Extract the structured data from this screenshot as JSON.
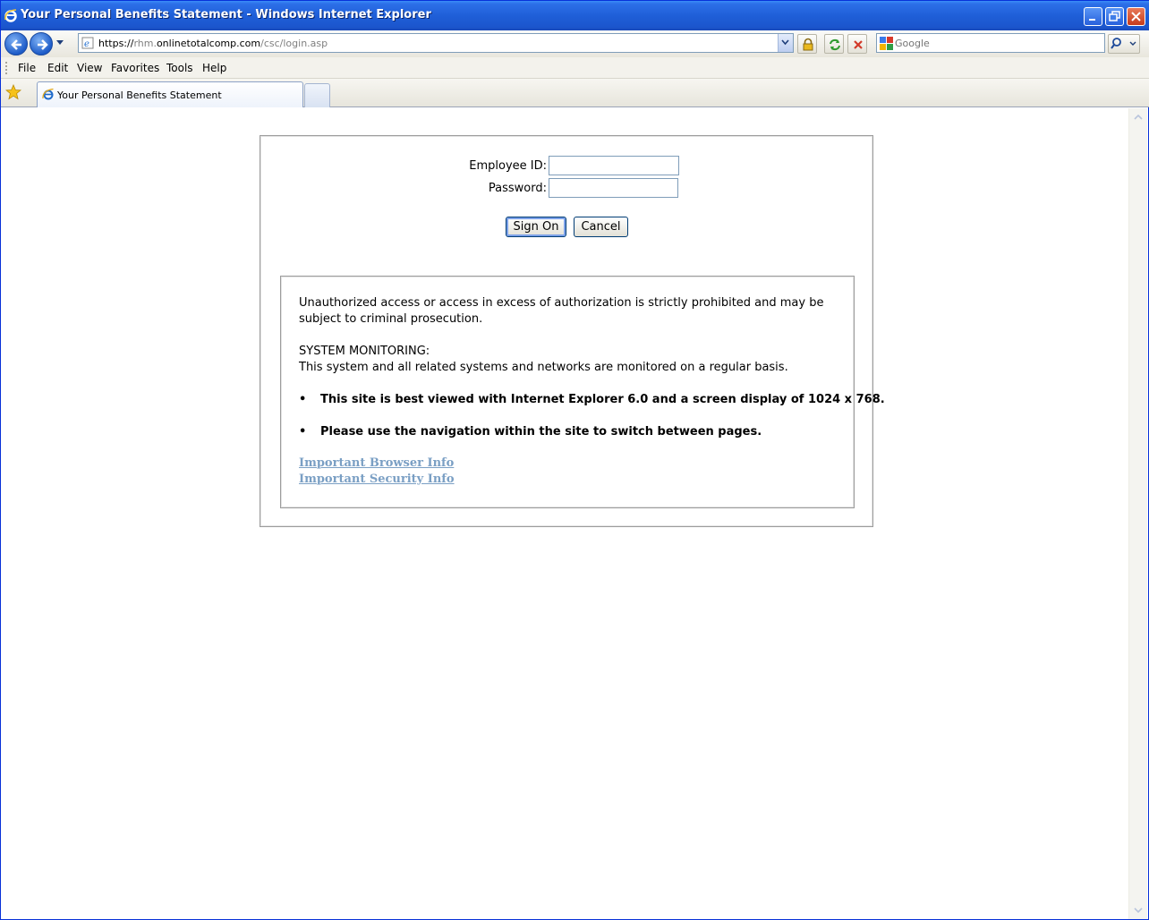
{
  "window": {
    "title": "Your Personal Benefits Statement - Windows Internet Explorer"
  },
  "address_bar": {
    "url_protocol": "https://",
    "url_sub": "rhm.",
    "url_domain": "onlinetotalcomp.com",
    "url_path": "/csc/login.asp"
  },
  "search": {
    "placeholder": "Google"
  },
  "menu": {
    "items": [
      "File",
      "Edit",
      "View",
      "Favorites",
      "Tools",
      "Help"
    ]
  },
  "tabs": {
    "active_label": "Your Personal Benefits Statement"
  },
  "login": {
    "employee_id_label": "Employee ID:",
    "employee_id_value": "",
    "password_label": "Password:",
    "password_value": "",
    "sign_on_label": "Sign On",
    "cancel_label": "Cancel"
  },
  "notice": {
    "warning_line1": "Unauthorized access or access in excess of authorization is strictly prohibited and may be",
    "warning_line2": "subject to criminal prosecution.",
    "monitoring_title": "SYSTEM MONITORING:",
    "monitoring_text": "This system and all related systems and networks are monitored on a regular basis.",
    "bullets": [
      "This site is best viewed with Internet Explorer 6.0 and a screen display of 1024 x 768.",
      "Please use the navigation within the site to switch between pages."
    ],
    "bullet_symbol": "•",
    "links": [
      "Important Browser Info",
      "Important Security Info"
    ]
  },
  "icons": {
    "app": "ie-icon",
    "minimize": "minimize-icon",
    "maximize": "restore-icon",
    "close": "close-icon",
    "back": "back-arrow-icon",
    "forward": "forward-arrow-icon",
    "lock": "lock-icon",
    "refresh": "refresh-icon",
    "stop": "stop-icon",
    "search": "search-magnifier-icon",
    "favorites": "star-icon"
  },
  "colors": {
    "titlebar": "#1f5fd8",
    "link": "#7a9fc4",
    "border": "#9c9c9c"
  }
}
